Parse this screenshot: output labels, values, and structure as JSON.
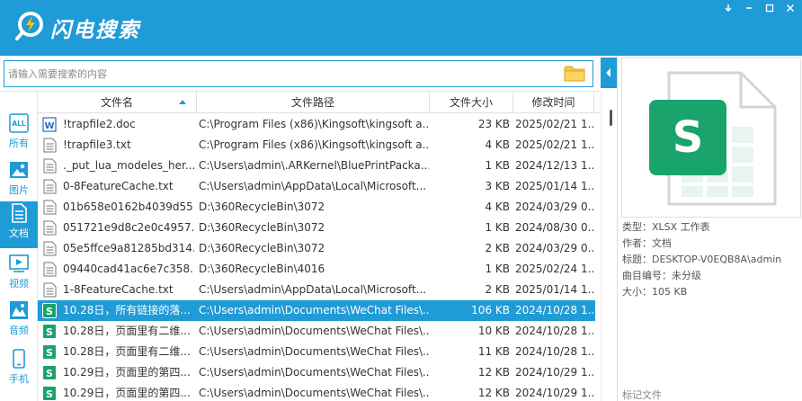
{
  "app": {
    "title": "闪电搜索",
    "window_controls": [
      "minimize",
      "restore",
      "maximize",
      "close"
    ]
  },
  "search": {
    "placeholder": "请输入需要搜索的内容",
    "value": ""
  },
  "sidebar": {
    "items": [
      {
        "icon": "all-icon",
        "icon_text": "ALL",
        "label": "所有",
        "active": false
      },
      {
        "icon": "image-icon",
        "label": "图片",
        "active": false
      },
      {
        "icon": "document-icon",
        "label": "文档",
        "active": true
      },
      {
        "icon": "video-icon",
        "label": "视频",
        "active": false
      },
      {
        "icon": "audio-icon",
        "label": "音频",
        "active": false
      },
      {
        "icon": "phone-icon",
        "label": "手机",
        "active": false
      }
    ]
  },
  "table": {
    "columns": [
      "文件名",
      "文件路径",
      "文件大小",
      "修改时间"
    ],
    "sorted_column": "文件名",
    "rows": [
      {
        "icon": "word-icon",
        "name": "!trapfile2.doc",
        "path": "C:\\Program Files (x86)\\Kingsoft\\kingsoft a...",
        "size": "23 KB",
        "date": "2025/02/21 1...",
        "selected": false
      },
      {
        "icon": "text-file-icon",
        "name": "!trapfile3.txt",
        "path": "C:\\Program Files (x86)\\Kingsoft\\kingsoft a...",
        "size": "4 KB",
        "date": "2025/02/21 1...",
        "selected": false
      },
      {
        "icon": "text-file-icon",
        "name": "._put_lua_modeles_her...",
        "path": "C:\\Users\\admin\\.ARKernel\\BluePrintPacka...",
        "size": "1 KB",
        "date": "2024/12/13 1...",
        "selected": false
      },
      {
        "icon": "text-file-icon",
        "name": "0-8FeatureCache.txt",
        "path": "C:\\Users\\admin\\AppData\\Local\\Microsoft...",
        "size": "3 KB",
        "date": "2025/01/14 1...",
        "selected": false
      },
      {
        "icon": "text-file-icon",
        "name": "01b658e0162b4039d55...",
        "path": "D:\\360RecycleBin\\3072",
        "size": "4 KB",
        "date": "2024/03/29 0...",
        "selected": false
      },
      {
        "icon": "text-file-icon",
        "name": "051721e9d8c2e0c4957...",
        "path": "D:\\360RecycleBin\\3072",
        "size": "1 KB",
        "date": "2024/08/30 0...",
        "selected": false
      },
      {
        "icon": "text-file-icon",
        "name": "05e5ffce9a81285bd314...",
        "path": "D:\\360RecycleBin\\3072",
        "size": "2 KB",
        "date": "2024/03/29 0...",
        "selected": false
      },
      {
        "icon": "text-file-icon",
        "name": "09440cad41ac6e7c358...",
        "path": "D:\\360RecycleBin\\4016",
        "size": "1 KB",
        "date": "2025/02/24 1...",
        "selected": false
      },
      {
        "icon": "text-file-icon",
        "name": "1-8FeatureCache.txt",
        "path": "C:\\Users\\admin\\AppData\\Local\\Microsoft...",
        "size": "2 KB",
        "date": "2025/01/14 1...",
        "selected": false
      },
      {
        "icon": "spreadsheet-icon",
        "name": "10.28日，所有链接的落...",
        "path": "C:\\Users\\admin\\Documents\\WeChat Files\\...",
        "size": "106 KB",
        "date": "2024/10/28 1...",
        "selected": true
      },
      {
        "icon": "spreadsheet-icon",
        "name": "10.28日，页面里有二维...",
        "path": "C:\\Users\\admin\\Documents\\WeChat Files\\...",
        "size": "10 KB",
        "date": "2024/10/28 1...",
        "selected": false
      },
      {
        "icon": "spreadsheet-icon",
        "name": "10.28日，页面里有二维...",
        "path": "C:\\Users\\admin\\Documents\\WeChat Files\\...",
        "size": "11 KB",
        "date": "2024/10/28 1...",
        "selected": false
      },
      {
        "icon": "spreadsheet-icon",
        "name": "10.29日，页面里的第四...",
        "path": "C:\\Users\\admin\\Documents\\WeChat Files\\...",
        "size": "12 KB",
        "date": "2024/10/29 1...",
        "selected": false
      },
      {
        "icon": "spreadsheet-icon",
        "name": "10.29日，页面里的第四...",
        "path": "C:\\Users\\admin\\Documents\\WeChat Files\\...",
        "size": "12 KB",
        "date": "2024/10/29 1...",
        "selected": false
      }
    ]
  },
  "preview": {
    "icon": "xlsx-file-icon",
    "icon_letter": "S",
    "type": "类型：XLSX 工作表",
    "author": "作者：文档",
    "title": "标题：DESKTOP-V0EQB8A\\admin",
    "track": "曲目编号：未分级",
    "size": "大小：105 KB",
    "tag_label": "标记文件"
  },
  "colors": {
    "brand": "#1f9bd7",
    "spreadsheet": "#1aa36a"
  }
}
